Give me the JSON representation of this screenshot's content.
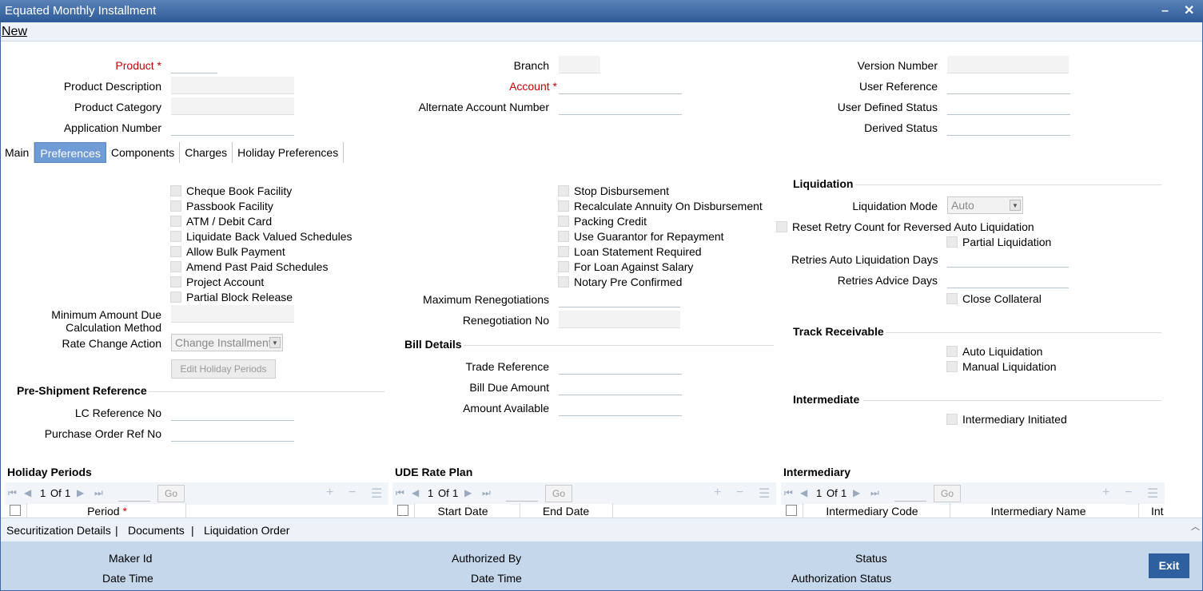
{
  "window": {
    "title": "Equated Monthly Installment",
    "minimize": "–",
    "close": "✕"
  },
  "toolbar": {
    "new_label": "New"
  },
  "header": {
    "product_label": "Product",
    "product_value": "",
    "product_description_label": "Product Description",
    "product_category_label": "Product Category",
    "application_number_label": "Application Number",
    "branch_label": "Branch",
    "account_label": "Account",
    "alternate_account_label": "Alternate Account Number",
    "version_number_label": "Version Number",
    "user_reference_label": "User Reference",
    "user_defined_status_label": "User Defined Status",
    "derived_status_label": "Derived Status",
    "required_mark": "*"
  },
  "tabs": [
    "Main",
    "Preferences",
    "Components",
    "Charges",
    "Holiday Preferences"
  ],
  "active_tab": "Preferences",
  "prefs_left": [
    "Cheque Book Facility",
    "Passbook Facility",
    "ATM / Debit Card",
    "Liquidate Back Valued Schedules",
    "Allow Bulk Payment",
    "Amend Past Paid Schedules",
    "Project Account",
    "Partial Block Release"
  ],
  "prefs_mid": [
    "Stop Disbursement",
    "Recalculate Annuity On Disbursement",
    "Packing Credit",
    "Use Guarantor for Repayment",
    "Loan Statement Required",
    "For Loan Against Salary",
    "Notary Pre Confirmed"
  ],
  "min_amount_label": "Minimum Amount Due Calculation Method",
  "rate_change_label": "Rate Change Action",
  "rate_change_value": "Change Installment",
  "edit_holiday_label": "Edit Holiday Periods",
  "pre_shipment": {
    "title": "Pre-Shipment Reference",
    "lc_label": "LC Reference No",
    "po_label": "Purchase Order Ref No"
  },
  "renego": {
    "max_label": "Maximum Renegotiations",
    "no_label": "Renegotiation No"
  },
  "bill": {
    "title": "Bill Details",
    "trade_label": "Trade Reference",
    "due_label": "Bill Due Amount",
    "avail_label": "Amount Available"
  },
  "liquidation": {
    "title": "Liquidation",
    "mode_label": "Liquidation Mode",
    "mode_value": "Auto",
    "reset_label": "Reset Retry Count for Reversed Auto Liquidation",
    "partial_label": "Partial Liquidation",
    "retries_auto_label": "Retries Auto Liquidation Days",
    "retries_advice_label": "Retries Advice Days",
    "close_collateral_label": "Close Collateral"
  },
  "track": {
    "title": "Track Receivable",
    "auto_label": "Auto Liquidation",
    "manual_label": "Manual Liquidation"
  },
  "intermediate": {
    "title": "Intermediate",
    "initiated_label": "Intermediary Initiated"
  },
  "grids": {
    "holiday": {
      "title": "Holiday Periods",
      "page": "1",
      "of": "Of",
      "total": "1",
      "go": "Go",
      "cols": [
        "Period"
      ]
    },
    "ude": {
      "title": "UDE Rate Plan",
      "page": "1",
      "of": "Of",
      "total": "1",
      "go": "Go",
      "cols": [
        "Start Date",
        "End Date"
      ]
    },
    "intermediary": {
      "title": "Intermediary",
      "page": "1",
      "of": "Of",
      "total": "1",
      "go": "Go",
      "cols": [
        "Intermediary Code",
        "Intermediary Name",
        "Int"
      ]
    }
  },
  "links": [
    "Securitization Details",
    "|",
    "Documents",
    "|",
    "Liquidation Order"
  ],
  "footer": {
    "maker_id": "Maker Id",
    "date_time": "Date Time",
    "authorized_by": "Authorized By",
    "date_time2": "Date Time",
    "status": "Status",
    "authorization_status": "Authorization Status",
    "exit": "Exit"
  }
}
